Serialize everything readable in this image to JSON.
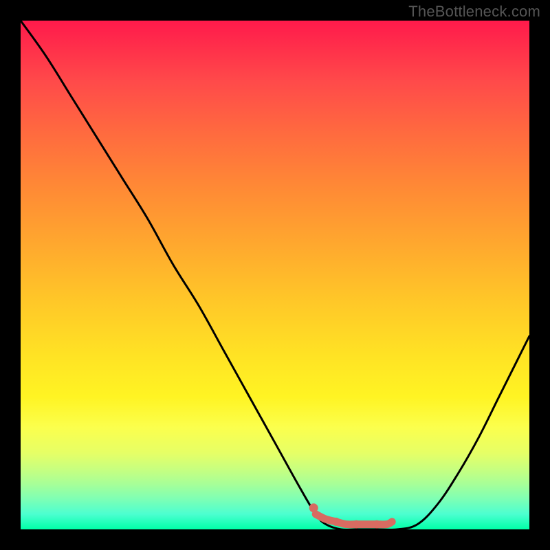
{
  "watermark": "TheBottleneck.com",
  "colors": {
    "curve": "#000000",
    "marker": "#d86b61"
  },
  "chart_data": {
    "type": "line",
    "title": "",
    "xlabel": "",
    "ylabel": "",
    "xlim": [
      0,
      100
    ],
    "ylim": [
      0,
      100
    ],
    "grid": false,
    "legend": false,
    "series": [
      {
        "name": "bottleneck_curve",
        "x": [
          0,
          5,
          10,
          15,
          20,
          25,
          30,
          35,
          40,
          45,
          50,
          55,
          58,
          60,
          63,
          66,
          70,
          74,
          78,
          82,
          86,
          90,
          94,
          98,
          100
        ],
        "y": [
          100,
          93,
          85,
          77,
          69,
          61,
          52,
          44,
          35,
          26,
          17,
          8,
          3,
          1,
          0,
          0,
          0,
          0,
          1,
          5,
          11,
          18,
          26,
          34,
          38
        ]
      }
    ],
    "markers": {
      "name": "optimal_range",
      "style": "dots_and_line",
      "color": "#d86b61",
      "points_x": [
        58,
        60,
        62,
        64,
        66,
        68,
        70,
        72,
        73
      ],
      "points_y": [
        3,
        2,
        1.5,
        1,
        1,
        1,
        1,
        1,
        1.5
      ]
    }
  }
}
